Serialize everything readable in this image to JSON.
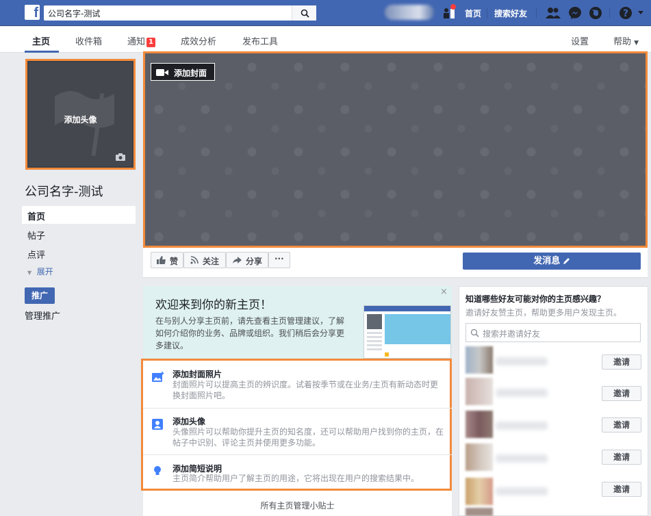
{
  "topbar": {
    "logo": "f",
    "search_value": "公司名字-测试",
    "links": {
      "home": "首页",
      "find_friends": "搜索好友"
    },
    "icons": [
      "search-icon",
      "friend-requests-icon",
      "friends-icon",
      "messenger-icon",
      "globe-icon",
      "help-icon",
      "caret-down-icon"
    ],
    "brand_color": "#4267b2"
  },
  "tabs": {
    "home": "主页",
    "inbox": "收件箱",
    "notifications": "通知",
    "notification_count": "1",
    "insights": "成效分析",
    "publishing_tools": "发布工具",
    "settings": "设置",
    "help": "帮助"
  },
  "left": {
    "profile_label": "添加头像",
    "page_name": "公司名字-测试",
    "nav": [
      "首页",
      "帖子",
      "点评"
    ],
    "see_more": "展开",
    "promote": "推广",
    "manage_promotions": "管理推广"
  },
  "cover": {
    "add_cover": "添加封面"
  },
  "actions": {
    "like": "赞",
    "follow": "关注",
    "share": "分享",
    "more": "···",
    "send_message": "发消息"
  },
  "welcome": {
    "title": "欢迎来到你的新主页！",
    "desc": "在与别人分享主页前，请先查看主页管理建议，了解如何介绍你的业务、品牌或组织。我们稍后会分享更多建议。",
    "close": "×",
    "tips": [
      {
        "title": "添加封面照片",
        "desc": "封面照片可以提高主页的辨识度。试着按季节或在业务/主页有新动态时更换封面照片吧。"
      },
      {
        "title": "添加头像",
        "desc": "头像照片可以帮助你提升主页的知名度，还可以帮助用户找到你的主页，在帖子中识别、评论主页并使用更多功能。"
      },
      {
        "title": "添加简短说明",
        "desc": "主页简介帮助用户了解主页的用途，它将出现在用户的搜索结果中。"
      }
    ],
    "all_tips": "所有主页管理小贴士"
  },
  "invite": {
    "title": "知道哪些好友可能对你的主页感兴趣？",
    "subtitle": "邀请好友赞主页，帮助更多用户发现主页。",
    "search_placeholder": "搜索并邀请好友",
    "invite_label": "邀请",
    "friend_count": 5
  },
  "highlight_color": "#f38a3b"
}
